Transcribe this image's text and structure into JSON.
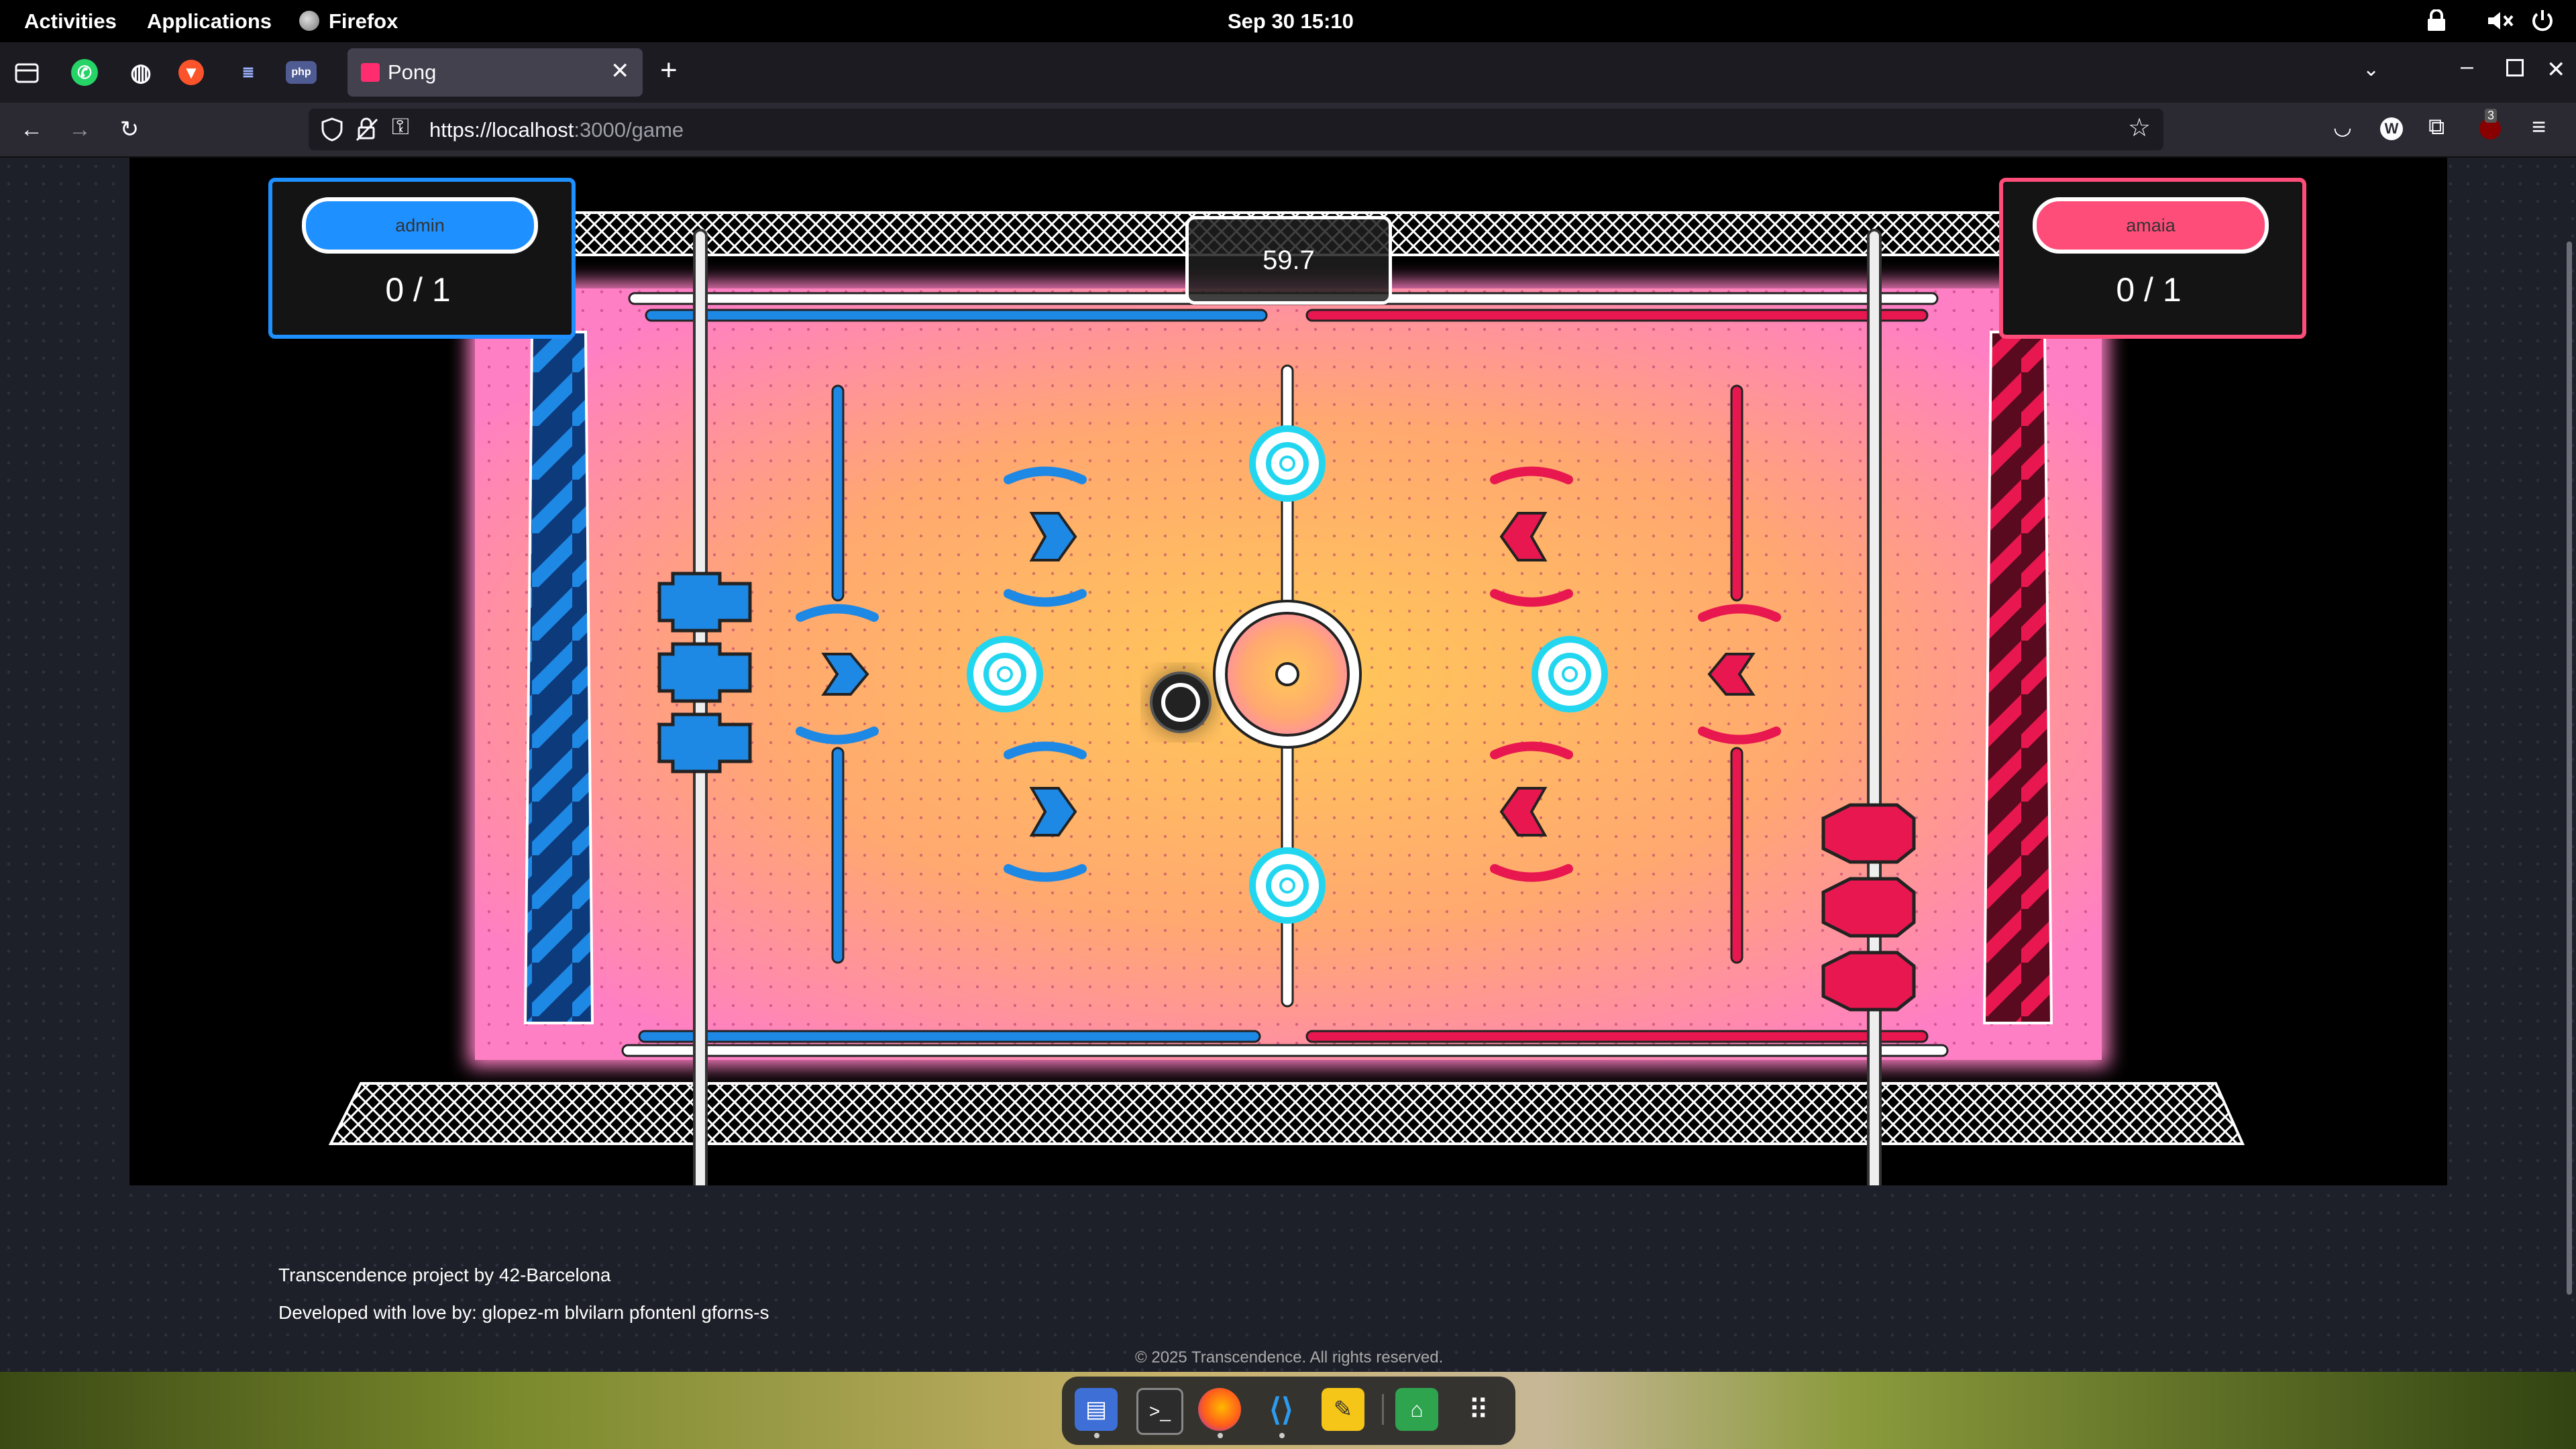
{
  "system_bar": {
    "activities": "Activities",
    "applications": "Applications",
    "app_name": "Firefox",
    "datetime": "Sep 30  15:10"
  },
  "browser": {
    "tab_title": "Pong",
    "url_host": "https://localhost",
    "url_path": ":3000/game",
    "pinned_tabs": [
      "whatsapp-icon",
      "globe-icon",
      "brave-icon",
      "site-icon",
      "php-icon"
    ],
    "notification_badge": "3"
  },
  "game": {
    "timer": "59.7",
    "player_left": {
      "name": "admin",
      "score": "0 / 1",
      "color": "#1e90ff"
    },
    "player_right": {
      "name": "amaia",
      "score": "0 / 1",
      "color": "#ff4d7a"
    },
    "field_colors": {
      "center": "#ffc857",
      "edge": "#ff7fc4",
      "blue": "#1e88e5",
      "red": "#e8174f"
    }
  },
  "footer": {
    "line1": "Transcendence project by 42-Barcelona",
    "line2": "Developed with love by: glopez-m blvilarn pfontenl gforns-s",
    "copyright": "© 2025 Transcendence. All rights reserved."
  },
  "dock": {
    "apps": [
      "files-icon",
      "terminal-icon",
      "firefox-icon",
      "vscode-icon",
      "notes-icon",
      "store-icon",
      "app-grid-icon"
    ]
  }
}
